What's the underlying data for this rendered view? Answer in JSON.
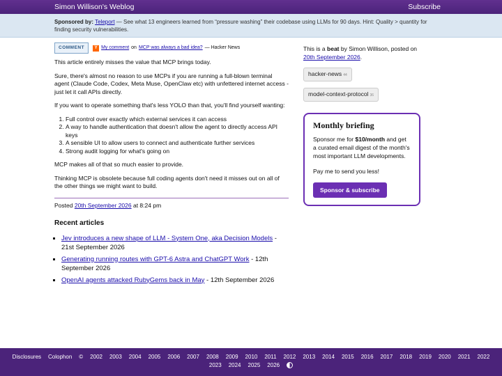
{
  "header": {
    "site_title": "Simon Willison's Weblog",
    "subscribe_label": "Subscribe"
  },
  "sponsor": {
    "prefix": "Sponsored by:",
    "company": "Teleport",
    "message": " — See what 13 engineers learned from “pressure washing” their codebase using LLMs for 90 days. Hint: Quality > quantity for finding security vulnerabilities."
  },
  "comment": {
    "badge": "COMMENT",
    "hn_letter": "Y",
    "my_comment": "My comment",
    "on": "on",
    "post_link": "MCP was always a bad idea?",
    "source": "— Hacker News"
  },
  "article": {
    "p1": "This article entirely misses the value that MCP brings today.",
    "p2": "Sure, there's almost no reason to use MCPs if you are running a full-blown terminal agent (Claude Code, Codex, Meta Muse, OpenClaw etc) with unfettered internet access - just let it call APIs directly.",
    "p3": "If you want to operate something that's less YOLO than that, you'll find yourself wanting:",
    "list": [
      "Full control over exactly which external services it can access",
      "A way to handle authentication that doesn't allow the agent to directly access API keys",
      "A sensible UI to allow users to connect and authenticate further services",
      "Strong audit logging for what's going on"
    ],
    "p4": "MCP makes all of that so much easier to provide.",
    "p5": "Thinking MCP is obsolete because full coding agents don't need it misses out on all of the other things we might want to build.",
    "posted_prefix": "Posted",
    "posted_date": "20th September 2026",
    "posted_time": "at 8:24 pm"
  },
  "recent": {
    "title": "Recent articles",
    "items": [
      {
        "title": "Jev introduces a new shape of LLM - System One, aka Decision Models",
        "date": " - 21st September 2026"
      },
      {
        "title": "Generating running routes with GPT-6 Astra and ChatGPT Work",
        "date": " - 12th September 2026"
      },
      {
        "title": "OpenAI agents attacked RubyGems back in May",
        "date": " - 12th September 2026"
      }
    ]
  },
  "sidebar": {
    "intro_1": "This is a",
    "beat": "beat",
    "intro_2": "by Simon Willison, posted on",
    "date": "20th September 2026",
    "tags": [
      {
        "label": "hacker-news",
        "count": "44"
      },
      {
        "label": "model-context-protocol",
        "count": "36"
      }
    ],
    "briefing": {
      "title": "Monthly briefing",
      "text_1": "Sponsor me for",
      "price": "$10/month",
      "text_2": "and get a curated email digest of the month's most important LLM developments.",
      "text_3": "Pay me to send you less!",
      "button": "Sponsor & subscribe"
    }
  },
  "footer": {
    "links": [
      "Disclosures",
      "Colophon",
      "©"
    ],
    "years_row1": [
      "2002",
      "2003",
      "2004",
      "2005",
      "2006",
      "2007",
      "2008",
      "2009",
      "2010",
      "2011",
      "2012",
      "2013",
      "2014",
      "2015",
      "2016",
      "2017",
      "2018",
      "2019",
      "2020",
      "2021",
      "2022"
    ],
    "years_row2": [
      "2023",
      "2024",
      "2025",
      "2026"
    ]
  },
  "colors": {
    "accent": "#4b237a",
    "button": "#6b2fb3",
    "sponsor_bg": "#dbe7f2"
  }
}
